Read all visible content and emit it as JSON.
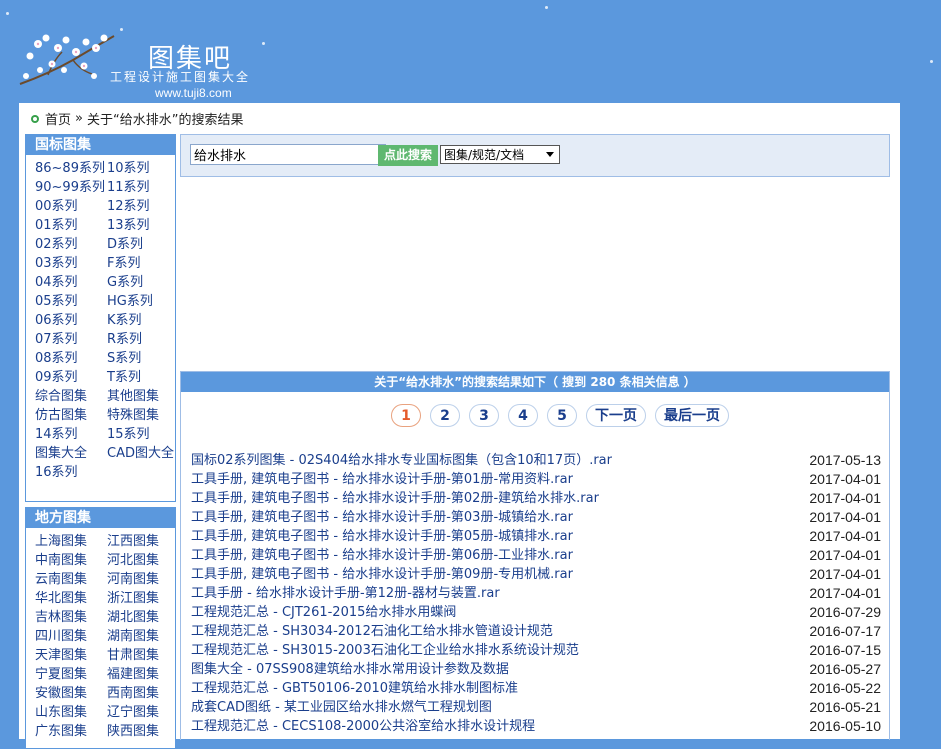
{
  "brand": {
    "title": "图集吧",
    "subtitle": "工程设计施工图集大全",
    "url": "www.tuji8.com"
  },
  "breadcrumb": {
    "home": "首页",
    "sep": "»",
    "current": "关于“给水排水”的搜索结果"
  },
  "left_national": {
    "heading": "国标图集",
    "items": [
      "86~89系列",
      "10系列",
      "90~99系列",
      "11系列",
      "00系列",
      "12系列",
      "01系列",
      "13系列",
      "02系列",
      "D系列",
      "03系列",
      "F系列",
      "04系列",
      "G系列",
      "05系列",
      "HG系列",
      "06系列",
      "K系列",
      "07系列",
      "R系列",
      "08系列",
      "S系列",
      "09系列",
      "T系列",
      "综合图集",
      "其他图集",
      "仿古图集",
      "特殊图集",
      "14系列",
      "15系列",
      "图集大全",
      "CAD图大全",
      "16系列"
    ]
  },
  "left_local": {
    "heading": "地方图集",
    "items": [
      "上海图集",
      "江西图集",
      "中南图集",
      "河北图集",
      "云南图集",
      "河南图集",
      "华北图集",
      "浙江图集",
      "吉林图集",
      "湖北图集",
      "四川图集",
      "湖南图集",
      "天津图集",
      "甘肃图集",
      "宁夏图集",
      "福建图集",
      "安徽图集",
      "西南图集",
      "山东图集",
      "辽宁图集",
      "广东图集",
      "陕西图集"
    ]
  },
  "search": {
    "value": "给水排水",
    "button": "点此搜索",
    "category": "图集/规范/文档"
  },
  "results": {
    "heading": "关于“给水排水”的搜索结果如下（ 搜到 280 条相关信息 ）",
    "pages": [
      "1",
      "2",
      "3",
      "4",
      "5",
      "下一页",
      "最后一页"
    ],
    "current_page": "1",
    "items": [
      {
        "title": "国标02系列图集 - 02S404给水排水专业国标图集（包含10和17页）.rar",
        "date": "2017-05-13"
      },
      {
        "title": "工具手册, 建筑电子图书 - 给水排水设计手册-第01册-常用资料.rar",
        "date": "2017-04-01"
      },
      {
        "title": "工具手册, 建筑电子图书 - 给水排水设计手册-第02册-建筑给水排水.rar",
        "date": "2017-04-01"
      },
      {
        "title": "工具手册, 建筑电子图书 - 给水排水设计手册-第03册-城镇给水.rar",
        "date": "2017-04-01"
      },
      {
        "title": "工具手册, 建筑电子图书 - 给水排水设计手册-第05册-城镇排水.rar",
        "date": "2017-04-01"
      },
      {
        "title": "工具手册, 建筑电子图书 - 给水排水设计手册-第06册-工业排水.rar",
        "date": "2017-04-01"
      },
      {
        "title": "工具手册, 建筑电子图书 - 给水排水设计手册-第09册-专用机械.rar",
        "date": "2017-04-01"
      },
      {
        "title": "工具手册 - 给水排水设计手册-第12册-器材与装置.rar",
        "date": "2017-04-01"
      },
      {
        "title": "工程规范汇总 - CJT261-2015给水排水用蝶阀",
        "date": "2016-07-29"
      },
      {
        "title": "工程规范汇总 - SH3034-2012石油化工给水排水管道设计规范",
        "date": "2016-07-17"
      },
      {
        "title": "工程规范汇总 - SH3015-2003石油化工企业给水排水系统设计规范",
        "date": "2016-07-15"
      },
      {
        "title": "图集大全 - 07SS908建筑给水排水常用设计参数及数据",
        "date": "2016-05-27"
      },
      {
        "title": "工程规范汇总 - GBT50106-2010建筑给水排水制图标准",
        "date": "2016-05-22"
      },
      {
        "title": "成套CAD图纸 - 某工业园区给水排水燃气工程规划图",
        "date": "2016-05-21"
      },
      {
        "title": "工程规范汇总 - CECS108-2000公共浴室给水排水设计规程",
        "date": "2016-05-10"
      }
    ]
  }
}
